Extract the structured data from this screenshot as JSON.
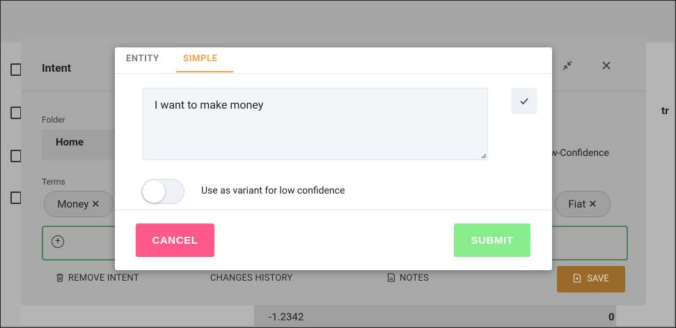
{
  "background": {
    "intent_title": "Intent",
    "folder_label": "Folder",
    "folder_value": "Home",
    "terms_label": "Terms",
    "chip_money": "Money ✕",
    "chip_fiat": "Fiat ✕",
    "low_confidence_fragment": "w-Confidence",
    "right_tab_fragment": "tr",
    "actions": {
      "remove_intent": "REMOVE INTENT",
      "changes_history": "CHANGES HISTORY",
      "notes": "NOTES",
      "save": "SAVE"
    },
    "row_text": "-1.2342",
    "row_value": "0"
  },
  "modal": {
    "tabs": [
      {
        "label": "ENTITY",
        "active": false
      },
      {
        "label": "SIMPLE",
        "active": true
      }
    ],
    "text_value": "I want to make money",
    "toggle_label": "Use as variant for low confidence",
    "toggle_on": false,
    "cancel_label": "CANCEL",
    "submit_label": "SUBMIT"
  },
  "colors": {
    "accent_tab": "#f5a04a",
    "cancel": "#ff5a8a",
    "submit": "#86ec8c",
    "save_dim": "#9a6a2a"
  },
  "icons": [
    "check-icon",
    "plus-circle-icon",
    "trash-icon",
    "notes-icon",
    "save-icon",
    "minimize-icon",
    "close-icon",
    "resize-grip-icon"
  ]
}
